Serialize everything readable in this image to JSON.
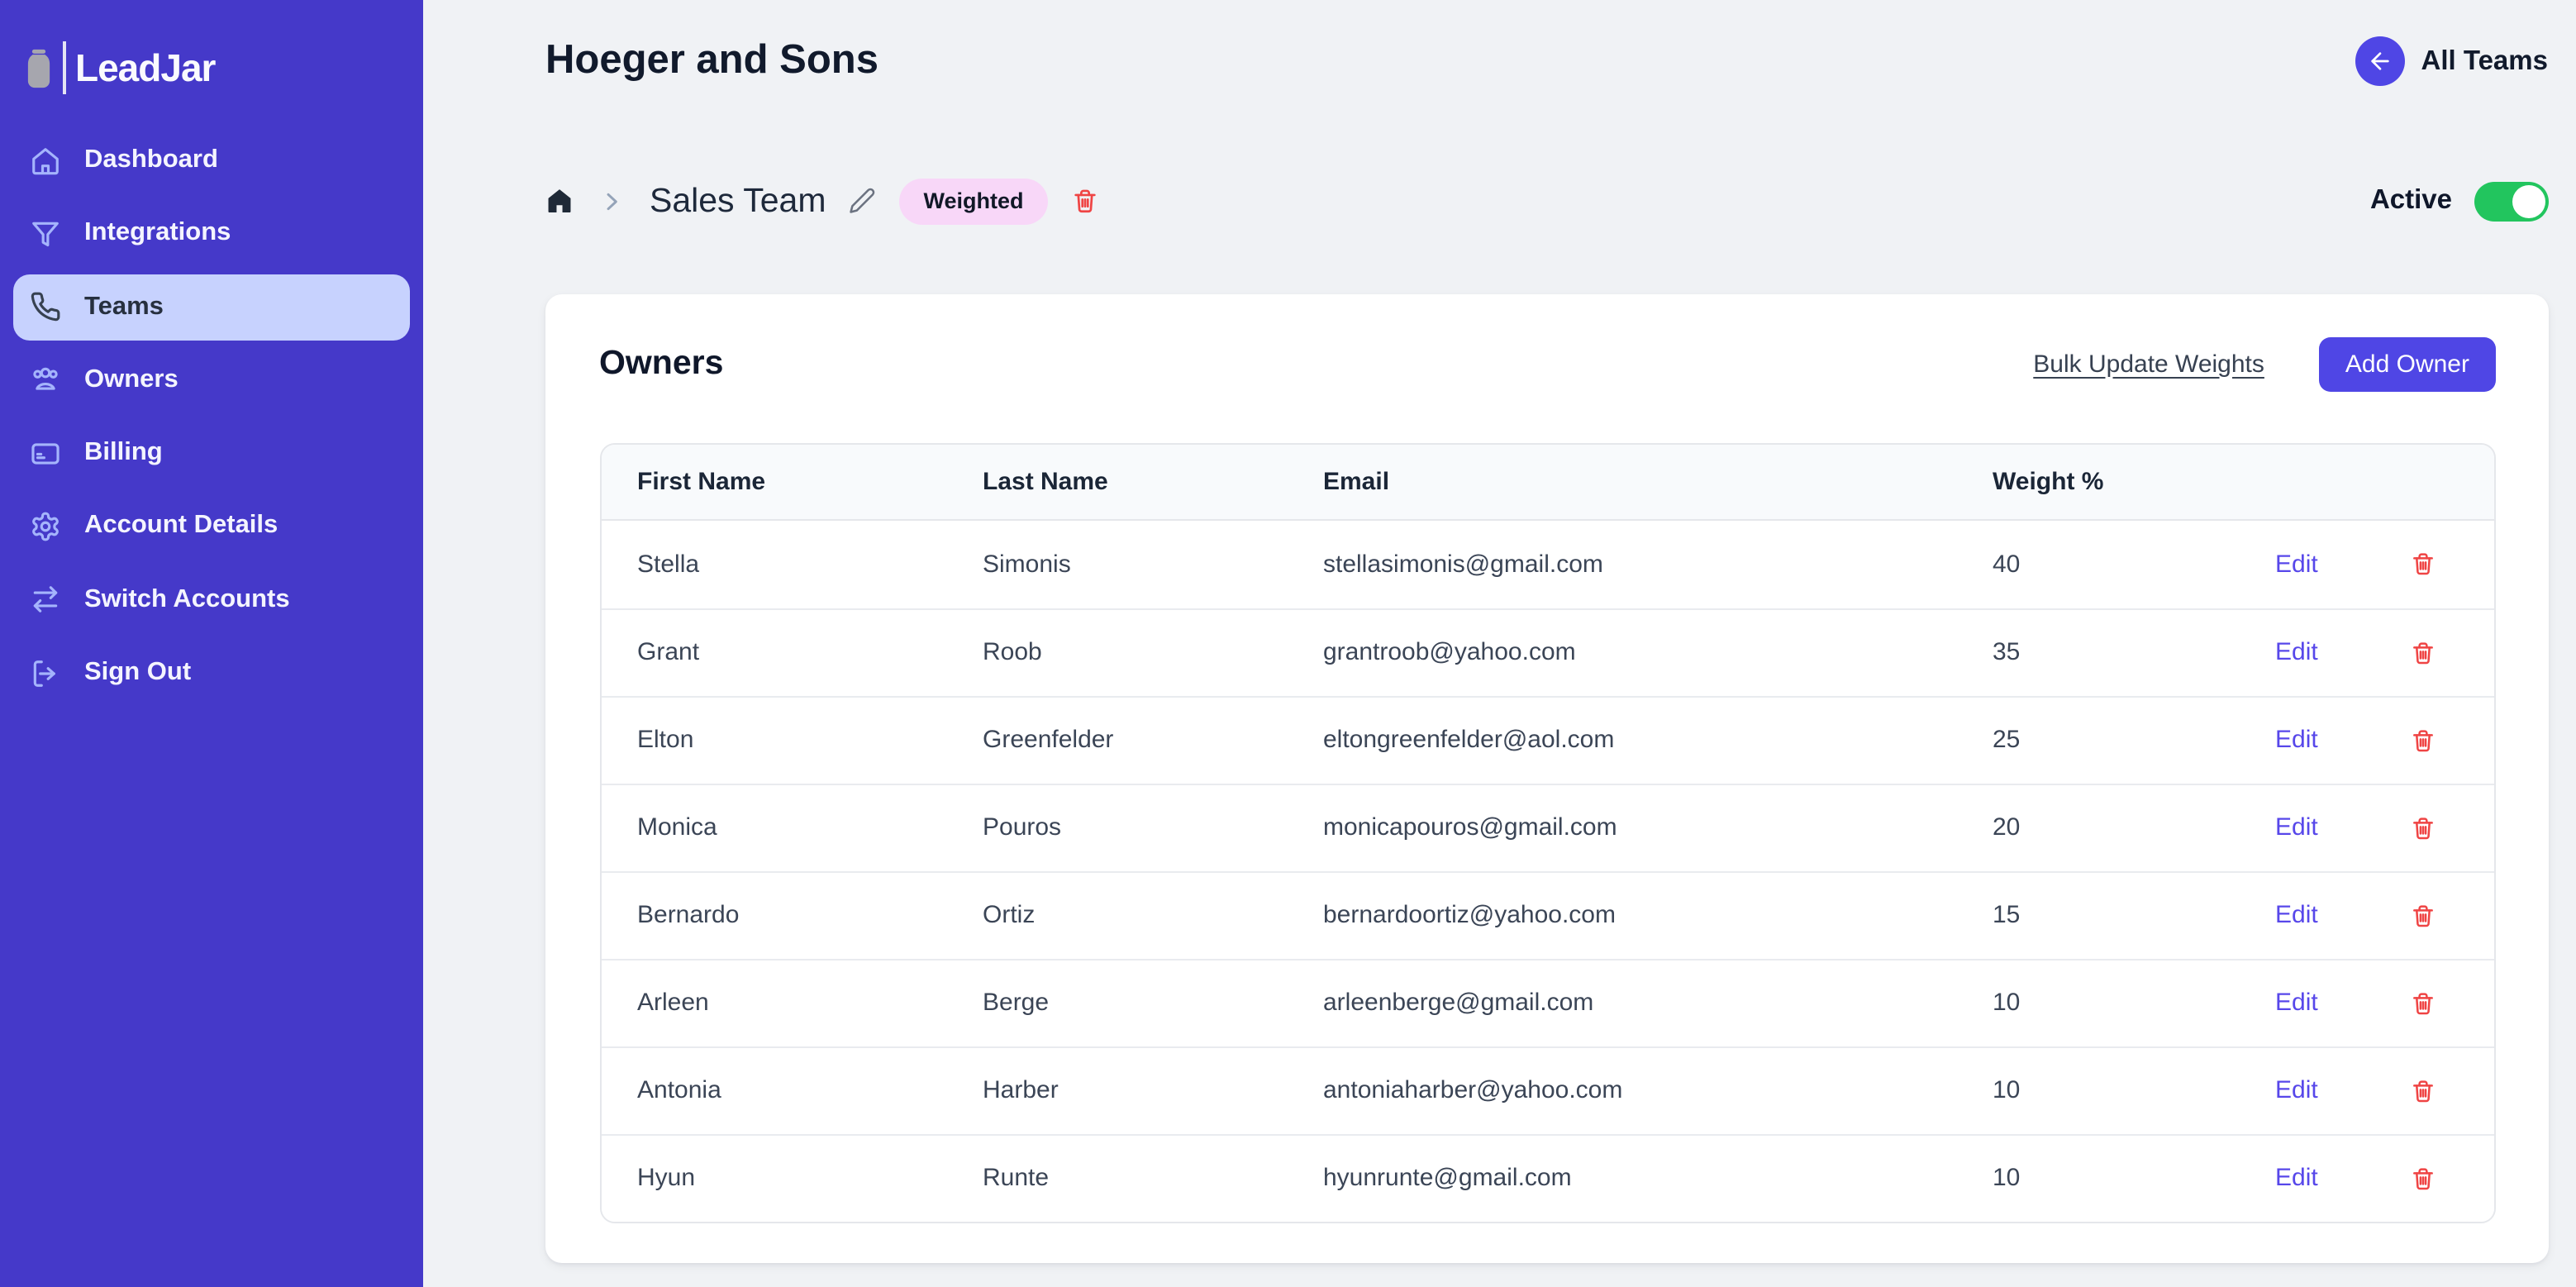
{
  "brand": {
    "name": "LeadJar"
  },
  "sidebar": {
    "items": [
      {
        "label": "Dashboard",
        "icon": "home-icon",
        "active": false
      },
      {
        "label": "Integrations",
        "icon": "funnel-icon",
        "active": false
      },
      {
        "label": "Teams",
        "icon": "phone-icon",
        "active": true
      },
      {
        "label": "Owners",
        "icon": "users-icon",
        "active": false
      },
      {
        "label": "Billing",
        "icon": "credit-card-icon",
        "active": false
      },
      {
        "label": "Account Details",
        "icon": "gear-icon",
        "active": false
      },
      {
        "label": "Switch Accounts",
        "icon": "switch-arrows-icon",
        "active": false
      },
      {
        "label": "Sign Out",
        "icon": "sign-out-icon",
        "active": false
      }
    ]
  },
  "header": {
    "title": "Hoeger and Sons",
    "all_teams_label": "All Teams"
  },
  "breadcrumb": {
    "team_name": "Sales Team",
    "badge_label": "Weighted"
  },
  "status_toggle": {
    "label": "Active",
    "state": "on"
  },
  "owners_card": {
    "title": "Owners",
    "bulk_update_label": "Bulk Update Weights",
    "add_owner_label": "Add Owner",
    "table": {
      "headers": [
        "First Name",
        "Last Name",
        "Email",
        "Weight %"
      ],
      "edit_label": "Edit",
      "rows": [
        {
          "first": "Stella",
          "last": "Simonis",
          "email": "stellasimonis@gmail.com",
          "weight": "40"
        },
        {
          "first": "Grant",
          "last": "Roob",
          "email": "grantroob@yahoo.com",
          "weight": "35"
        },
        {
          "first": "Elton",
          "last": "Greenfelder",
          "email": "eltongreenfelder@aol.com",
          "weight": "25"
        },
        {
          "first": "Monica",
          "last": "Pouros",
          "email": "monicapouros@gmail.com",
          "weight": "20"
        },
        {
          "first": "Bernardo",
          "last": "Ortiz",
          "email": "bernardoortiz@yahoo.com",
          "weight": "15"
        },
        {
          "first": "Arleen",
          "last": "Berge",
          "email": "arleenberge@gmail.com",
          "weight": "10"
        },
        {
          "first": "Antonia",
          "last": "Harber",
          "email": "antoniaharber@yahoo.com",
          "weight": "10"
        },
        {
          "first": "Hyun",
          "last": "Runte",
          "email": "hyunrunte@gmail.com",
          "weight": "10"
        }
      ]
    }
  },
  "colors": {
    "sidebar_bg": "#4539C9",
    "accent": "#4F46E5",
    "active_nav_bg": "#C7D2FE",
    "toggle_on": "#22C55E",
    "badge_bg": "#F8D7F8",
    "danger": "#EF4444",
    "page_bg": "#F0F2F5",
    "edit_link": "#5747EA"
  }
}
